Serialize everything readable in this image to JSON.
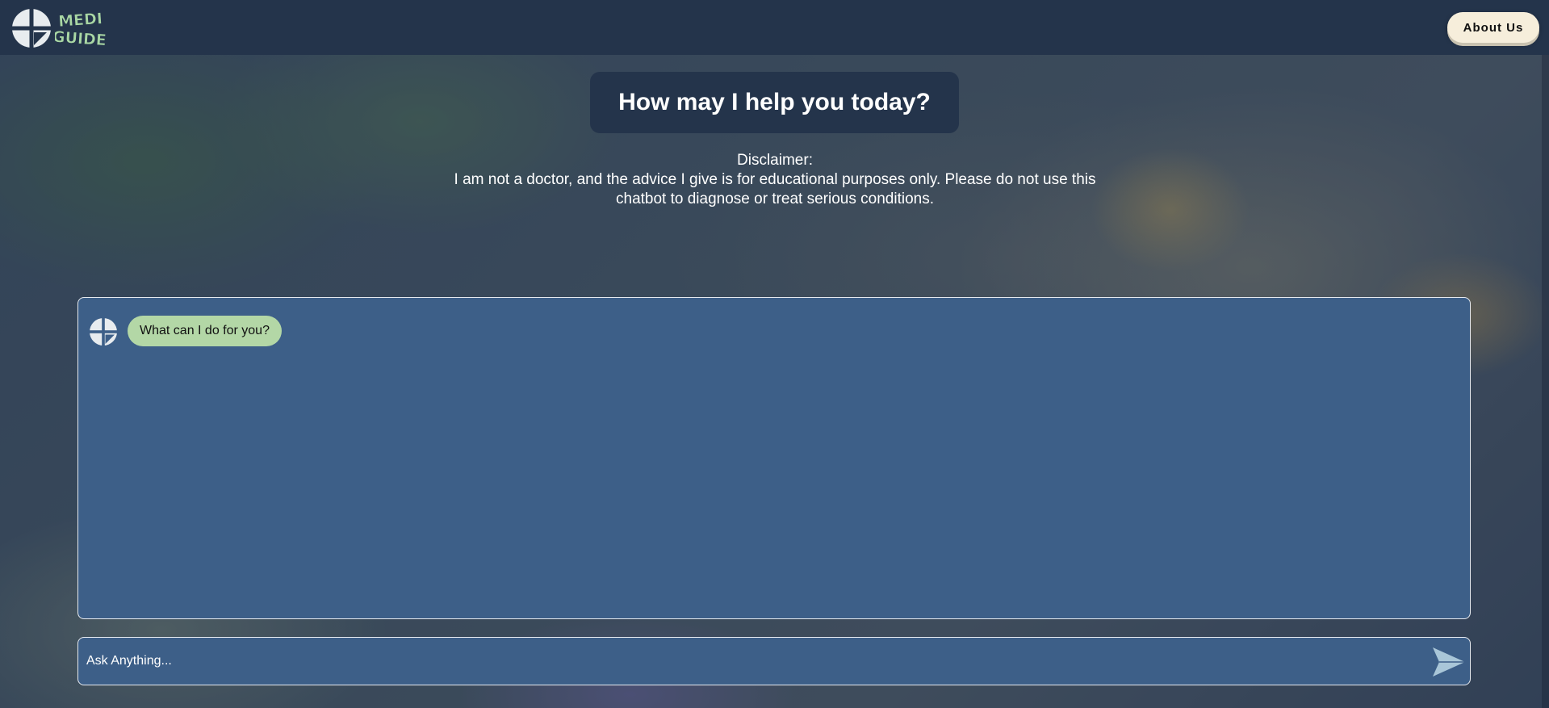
{
  "header": {
    "logo_icon": "medical-cross-circle-icon",
    "logo_text_line1": "MEDI",
    "logo_text_line2": "GUIDE",
    "about_label": "About Us"
  },
  "hero": {
    "title": "How may I help you today?",
    "disclaimer_heading": "Disclaimer:",
    "disclaimer_line1": "I am not a doctor, and the advice I give is for educational purposes only. Please do not use this",
    "disclaimer_line2": "chatbot to diagnose or treat serious conditions."
  },
  "chat": {
    "messages": [
      {
        "sender": "bot",
        "avatar_icon": "medical-cross-circle-icon",
        "text": "What can I do for you?"
      }
    ]
  },
  "input": {
    "placeholder": "Ask Anything...",
    "value": "",
    "send_icon": "send-icon"
  },
  "colors": {
    "topbar": "#24344b",
    "panel": "#3d5f88",
    "bot_bubble": "#b3d7a6",
    "logo_green": "#a9d7a4",
    "about_button": "#f6eedb",
    "send_icon": "#a9c6d8"
  }
}
